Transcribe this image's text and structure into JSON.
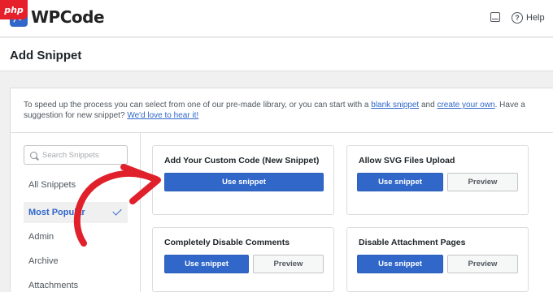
{
  "brand": {
    "name": "WPCode",
    "watermark": "php"
  },
  "topbar": {
    "help_label": "Help"
  },
  "page": {
    "title": "Add Snippet"
  },
  "intro": {
    "text_1": "To speed up the process you can select from one of our pre-made library, or you can start with a ",
    "link_blank": "blank snippet",
    "text_2": " and ",
    "link_create": "create your own",
    "text_3": ". Have a suggestion for new snippet? ",
    "link_feedback": "We'd love to hear it!"
  },
  "sidebar": {
    "search_placeholder": "Search Snippets",
    "categories": [
      {
        "label": "All Snippets",
        "active": false
      },
      {
        "label": "Most Popular",
        "active": true
      },
      {
        "label": "Admin",
        "active": false
      },
      {
        "label": "Archive",
        "active": false
      },
      {
        "label": "Attachments",
        "active": false
      }
    ]
  },
  "cards": [
    {
      "title": "Add Your Custom Code (New Snippet)",
      "use_label": "Use snippet"
    },
    {
      "title": "Allow SVG Files Upload",
      "use_label": "Use snippet",
      "preview_label": "Preview"
    },
    {
      "title": "Completely Disable Comments",
      "use_label": "Use snippet",
      "preview_label": "Preview"
    },
    {
      "title": "Disable Attachment Pages",
      "use_label": "Use snippet",
      "preview_label": "Preview"
    }
  ],
  "colors": {
    "accent": "#3067c9",
    "annotation": "#e0202a"
  }
}
